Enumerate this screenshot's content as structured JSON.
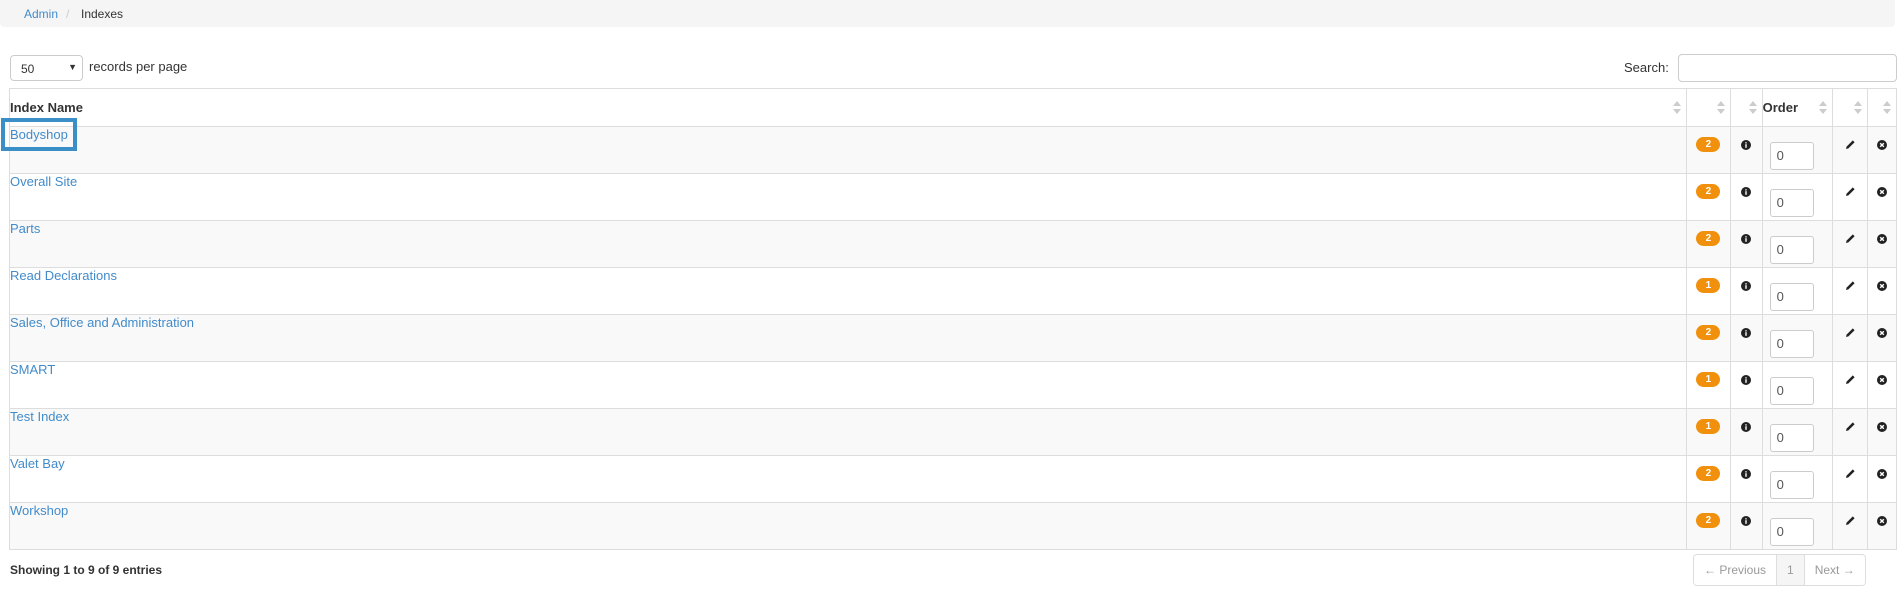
{
  "breadcrumb": {
    "root": "Admin",
    "separator": "/",
    "current": "Indexes"
  },
  "controls": {
    "length_value": "50",
    "length_label": "records per page",
    "search_label": "Search:",
    "search_value": ""
  },
  "table": {
    "headers": {
      "name": "Index Name",
      "order": "Order"
    },
    "rows": [
      {
        "name": "Bodyshop",
        "count": "2",
        "order": "0"
      },
      {
        "name": "Overall Site",
        "count": "2",
        "order": "0"
      },
      {
        "name": "Parts",
        "count": "2",
        "order": "0"
      },
      {
        "name": "Read Declarations",
        "count": "1",
        "order": "0"
      },
      {
        "name": "Sales, Office and Administration",
        "count": "2",
        "order": "0"
      },
      {
        "name": "SMART",
        "count": "1",
        "order": "0"
      },
      {
        "name": "Test Index",
        "count": "1",
        "order": "0"
      },
      {
        "name": "Valet Bay",
        "count": "2",
        "order": "0"
      },
      {
        "name": "Workshop",
        "count": "2",
        "order": "0"
      }
    ]
  },
  "footer": {
    "info": "Showing 1 to 9 of 9 entries",
    "prev": "← Previous",
    "page": "1",
    "next": "Next →"
  },
  "colors": {
    "link": "#428bca",
    "badge": "#f0900c",
    "highlight": "#3a8fc7"
  },
  "icons": {
    "info": "info-circle-icon",
    "edit": "pencil-icon",
    "delete": "close-circle-icon"
  }
}
